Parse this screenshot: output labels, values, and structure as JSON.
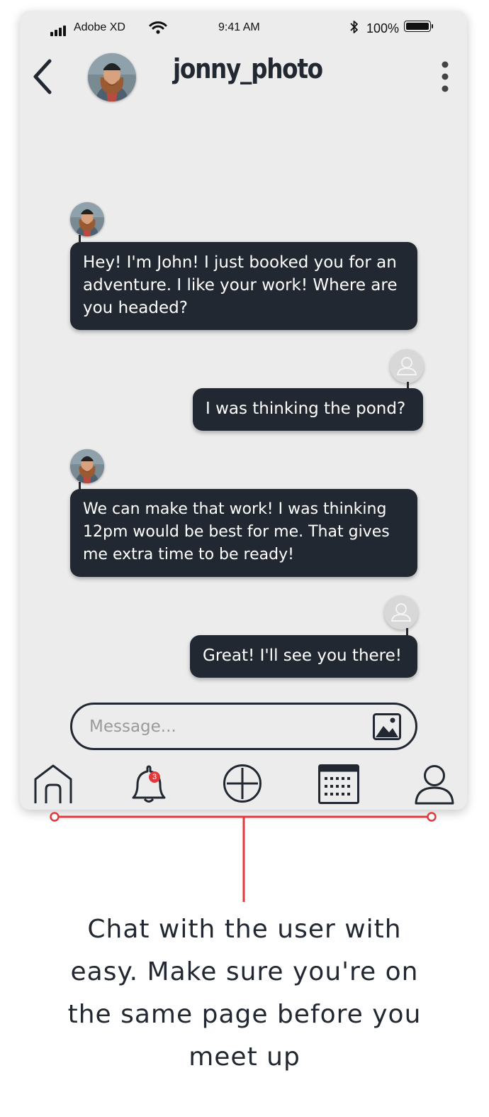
{
  "status_bar": {
    "carrier": "Adobe XD",
    "time": "9:41 AM",
    "battery_percent": "100%",
    "icons": [
      "signal-bars-icon",
      "wifi-icon",
      "bluetooth-icon",
      "battery-icon"
    ]
  },
  "header": {
    "back_icon": "chevron-left-icon",
    "username": "jonny_photo",
    "menu_icon": "more-vertical-icon"
  },
  "messages": [
    {
      "from": "jonny_photo",
      "text": "Hey! I'm John! I just booked you for an adventure. I like your work! Where are you headed?"
    },
    {
      "from": "me",
      "text": "I was thinking the pond?"
    },
    {
      "from": "jonny_photo",
      "text": "We can make that work! I was thinking 12pm would be best for me. That gives me extra time to be ready!"
    },
    {
      "from": "me",
      "text": "Great! I'll see you there!"
    }
  ],
  "composer": {
    "placeholder": "Message...",
    "attach_icon": "image-icon"
  },
  "bottom_nav": {
    "items": [
      {
        "icon": "home-icon"
      },
      {
        "icon": "bell-icon",
        "badge": "3"
      },
      {
        "icon": "add-circle-icon"
      },
      {
        "icon": "calendar-icon"
      },
      {
        "icon": "user-icon"
      }
    ]
  },
  "annotation": {
    "caption": "Chat with the user with easy. Make sure you're on the same page before you meet up",
    "line_color": "#e2393d"
  },
  "colors": {
    "background": "#ececec",
    "bubble": "#222831",
    "bubble_text": "#ffffff",
    "badge": "#e2393d"
  }
}
